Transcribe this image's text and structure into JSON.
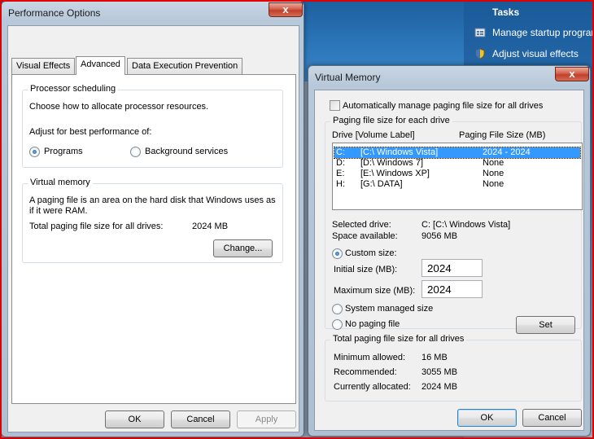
{
  "background": {
    "tasks_title": "Tasks",
    "tasks": [
      {
        "label": "Manage startup programs",
        "icon": "startup-programs-icon"
      },
      {
        "label": "Adjust visual effects",
        "icon": "shield-icon"
      }
    ]
  },
  "perf": {
    "title": "Performance Options",
    "close_label": "x",
    "tabs": [
      "Visual Effects",
      "Advanced",
      "Data Execution Prevention"
    ],
    "active_tab": "Advanced",
    "processor": {
      "legend": "Processor scheduling",
      "desc": "Choose how to allocate processor resources.",
      "adjust_label": "Adjust for best performance of:",
      "options": [
        "Programs",
        "Background services"
      ],
      "selected": "Programs"
    },
    "vm": {
      "legend": "Virtual memory",
      "desc_line1": "A paging file is an area on the hard disk that Windows uses as",
      "desc_line2": "if it were RAM.",
      "total_label": "Total paging file size for all drives:",
      "total_value": "2024 MB",
      "change_label": "Change..."
    },
    "buttons": {
      "ok": "OK",
      "cancel": "Cancel",
      "apply": "Apply"
    }
  },
  "vmdlg": {
    "title": "Virtual Memory",
    "close_label": "x",
    "auto_manage_label": "Automatically manage paging file size for all drives",
    "auto_manage_checked": false,
    "paging_group_legend": "Paging file size for each drive",
    "col_drive": "Drive  [Volume Label]",
    "col_size": "Paging File Size (MB)",
    "drives": [
      {
        "drive": "C:",
        "label": "[C:\\ Windows Vista]",
        "size": "2024 - 2024",
        "selected": true
      },
      {
        "drive": "D:",
        "label": "[D:\\ Windows 7]",
        "size": "None",
        "selected": false
      },
      {
        "drive": "E:",
        "label": "[E:\\ Windows XP]",
        "size": "None",
        "selected": false
      },
      {
        "drive": "H:",
        "label": "[G:\\ DATA]",
        "size": "None",
        "selected": false
      }
    ],
    "selected_drive_label": "Selected drive:",
    "selected_drive_value": "C:  [C:\\ Windows Vista]",
    "space_label": "Space available:",
    "space_value": "9056 MB",
    "custom_size_label": "Custom size:",
    "initial_label": "Initial size (MB):",
    "initial_value": "2024",
    "max_label": "Maximum size (MB):",
    "max_value": "2024",
    "system_managed_label": "System managed size",
    "no_paging_label": "No paging file",
    "selected_option": "Custom size",
    "set_label": "Set",
    "totals_legend": "Total paging file size for all drives",
    "min_label": "Minimum allowed:",
    "min_value": "16 MB",
    "rec_label": "Recommended:",
    "rec_value": "3055 MB",
    "cur_label": "Currently allocated:",
    "cur_value": "2024 MB",
    "buttons": {
      "ok": "OK",
      "cancel": "Cancel"
    }
  }
}
